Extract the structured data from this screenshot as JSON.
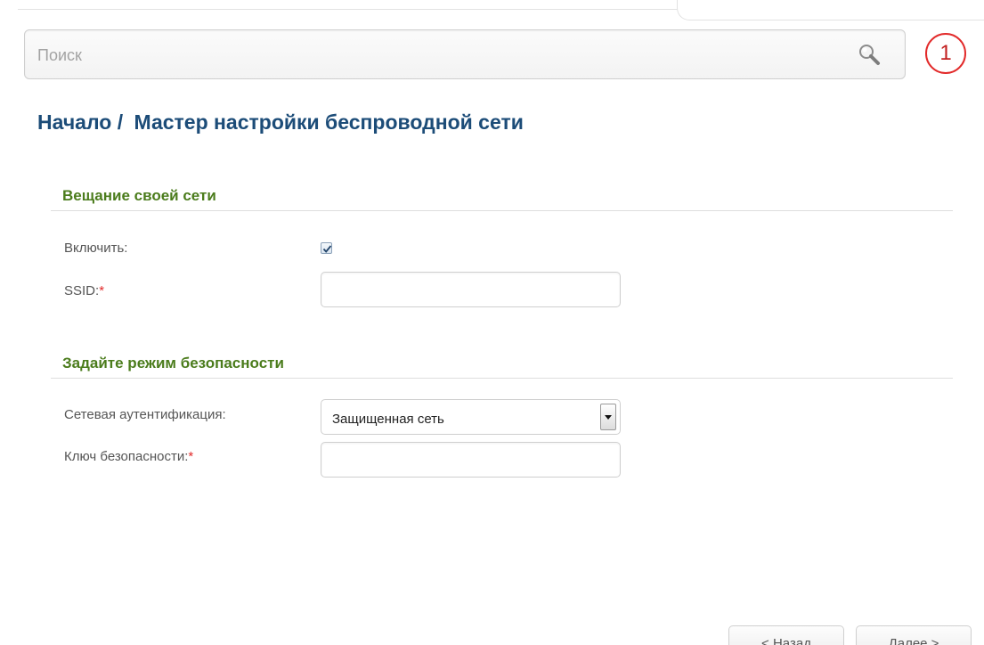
{
  "search": {
    "placeholder": "Поиск",
    "icon": "search-icon"
  },
  "notification": {
    "count": "1",
    "color": "#e22a2a"
  },
  "breadcrumb": {
    "home": "Начало /",
    "current": "Мастер настройки беспроводной сети"
  },
  "sections": {
    "broadcast": {
      "title": "Вещание своей сети",
      "enable_label": "Включить:",
      "enable_checked": true,
      "ssid_label": "SSID:",
      "ssid_required": "*",
      "ssid_value": ""
    },
    "security": {
      "title": "Задайте режим безопасности",
      "auth_label": "Сетевая аутентификация:",
      "auth_value": "Защищенная сеть",
      "key_label": "Ключ безопасности:",
      "key_required": "*",
      "key_value": ""
    }
  },
  "buttons": {
    "back": "< Назад",
    "next": "Далее >"
  },
  "colors": {
    "title": "#1c4c78",
    "section": "#4b7c1c",
    "required": "#e22a2a"
  }
}
